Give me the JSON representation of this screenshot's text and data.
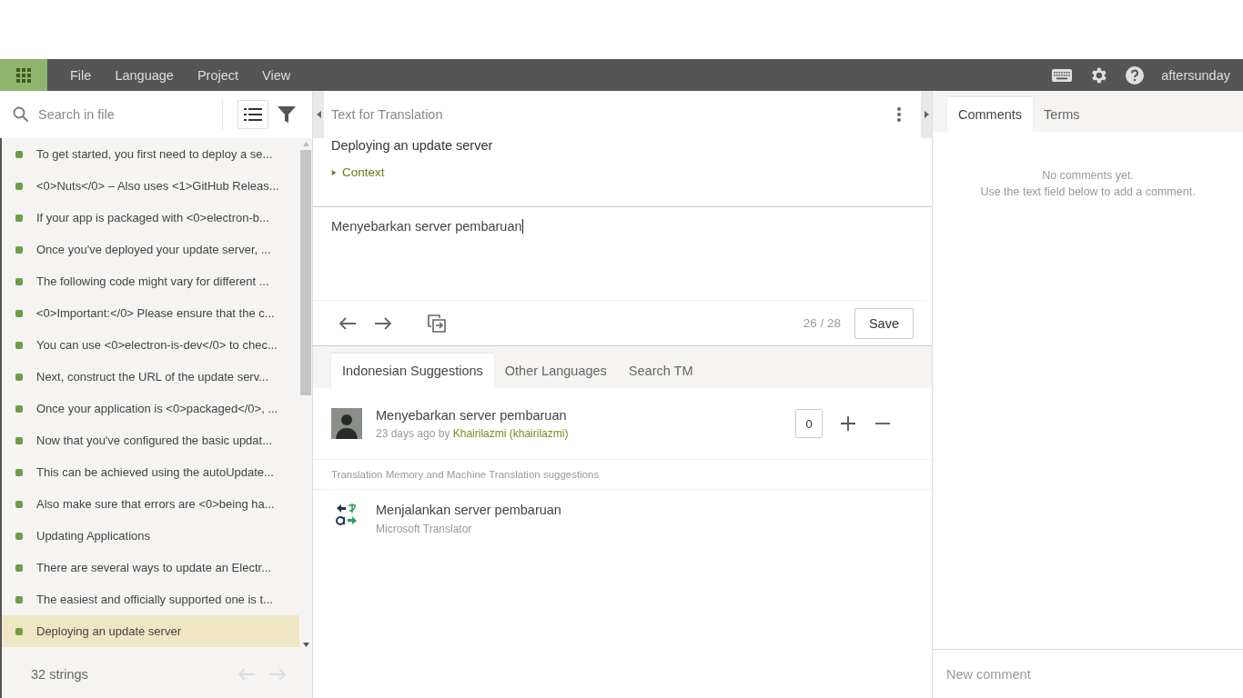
{
  "menubar": {
    "menus": [
      "File",
      "Language",
      "Project",
      "View"
    ],
    "user": "aftersunday"
  },
  "strings_panel": {
    "search": {
      "placeholder": "Search in file"
    },
    "items": [
      {
        "text": "To get started, you first need to deploy a se...",
        "selected": false
      },
      {
        "text": "<0>Nuts</0> – Also uses <1>GitHub Releas...",
        "selected": false
      },
      {
        "text": "If your app is packaged with <0>electron-b...",
        "selected": false
      },
      {
        "text": "Once you've deployed your update server, ...",
        "selected": false
      },
      {
        "text": "The following code might vary for different ...",
        "selected": false
      },
      {
        "text": "<0>Important:</0> Please ensure that the c...",
        "selected": false
      },
      {
        "text": "You can use <0>electron-is-dev</0> to chec...",
        "selected": false
      },
      {
        "text": "Next, construct the URL of the update serv...",
        "selected": false
      },
      {
        "text": "Once your application is <0>packaged</0>, ...",
        "selected": false
      },
      {
        "text": "Now that you've configured the basic updat...",
        "selected": false
      },
      {
        "text": "This can be achieved using the autoUpdate...",
        "selected": false
      },
      {
        "text": "Also make sure that errors are <0>being ha...",
        "selected": false
      },
      {
        "text": "Updating Applications",
        "selected": false
      },
      {
        "text": "There are several ways to update an Electr...",
        "selected": false
      },
      {
        "text": "The easiest and officially supported one is t...",
        "selected": false
      },
      {
        "text": "Deploying an update server",
        "selected": true
      }
    ],
    "count": "32 strings"
  },
  "source": {
    "title": "Text for Translation",
    "text": "Deploying an update server",
    "context": {
      "label": "Context",
      "expanded": false
    }
  },
  "editor": {
    "value": "Menyebarkan server pembaruan",
    "counter": "26 / 28",
    "save": "Save"
  },
  "suggestion_tabs": [
    {
      "label": "Indonesian Suggestions",
      "selected": true
    },
    {
      "label": "Other Languages",
      "selected": false
    },
    {
      "label": "Search TM",
      "selected": false
    }
  ],
  "suggestions": [
    {
      "text": "Menyebarkan server pembaruan",
      "meta": "23 days ago by",
      "author": "Khairilazmi (khairilazmi)",
      "votes": "0"
    }
  ],
  "tm_heading": "Translation Memory and Machine Translation suggestions",
  "machine": [
    {
      "text": "Menjalankan server pembaruan",
      "source": "Microsoft Translator"
    }
  ],
  "comments": {
    "tabs": [
      {
        "label": "Comments",
        "selected": true
      },
      {
        "label": "Terms",
        "selected": false
      }
    ],
    "empty": [
      "No comments yet.",
      "Use the text field below to add a comment."
    ],
    "placeholder": "New comment"
  }
}
